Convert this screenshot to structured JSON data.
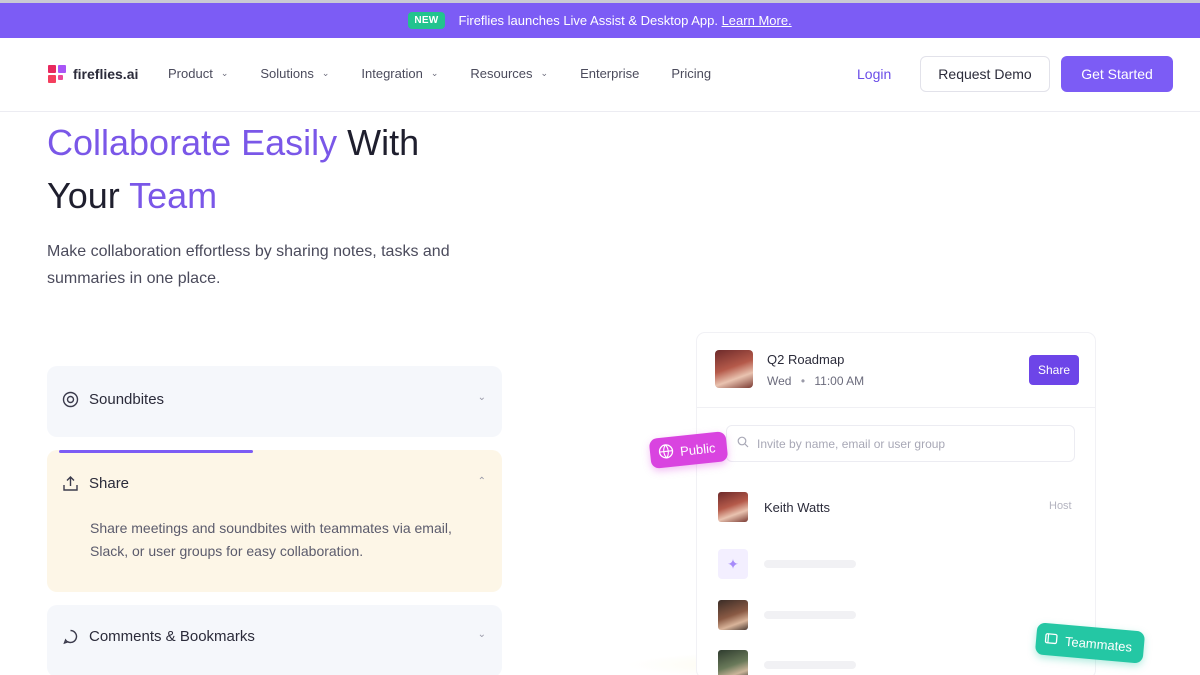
{
  "announcement": {
    "badge": "NEW",
    "text": "Fireflies launches Live Assist & Desktop App.",
    "link": "Learn More."
  },
  "nav": {
    "logo_text": "fireflies.ai",
    "menu": [
      {
        "label": "Product",
        "dropdown": true
      },
      {
        "label": "Solutions",
        "dropdown": true
      },
      {
        "label": "Integration",
        "dropdown": true
      },
      {
        "label": "Resources",
        "dropdown": true
      },
      {
        "label": "Enterprise",
        "dropdown": false
      },
      {
        "label": "Pricing",
        "dropdown": false
      }
    ],
    "login": "Login",
    "request_demo": "Request Demo",
    "get_started": "Get Started"
  },
  "hero": {
    "title_part1": "Collaborate Easily",
    "title_part2": " With",
    "title_part3": "Your ",
    "title_part4": "Team",
    "subtitle": "Make collaboration effortless by sharing notes, tasks and summaries in one place."
  },
  "features": [
    {
      "label": "Soundbites",
      "expanded": false,
      "icon": "play-circle-icon"
    },
    {
      "label": "Share",
      "expanded": true,
      "icon": "share-upload-icon",
      "progress": 0.45,
      "description": "Share meetings and soundbites with teammates via email, Slack, or user groups for easy collaboration."
    },
    {
      "label": "Comments & Bookmarks",
      "expanded": false,
      "icon": "comment-icon"
    }
  ],
  "share_mockup": {
    "meeting_title": "Q2 Roadmap",
    "meeting_day": "Wed",
    "meeting_time": "11:00 AM",
    "share_button": "Share",
    "invite_placeholder": "Invite by name, email or user group",
    "public_label": "Public",
    "host_name": "Keith Watts",
    "host_role": "Host",
    "teammates_label": "Teammates"
  },
  "colors": {
    "brand_purple": "#7c5cf5",
    "public_pink": "#d944e0",
    "teammates_green": "#24c7a4",
    "new_badge_green": "#22c38e"
  }
}
